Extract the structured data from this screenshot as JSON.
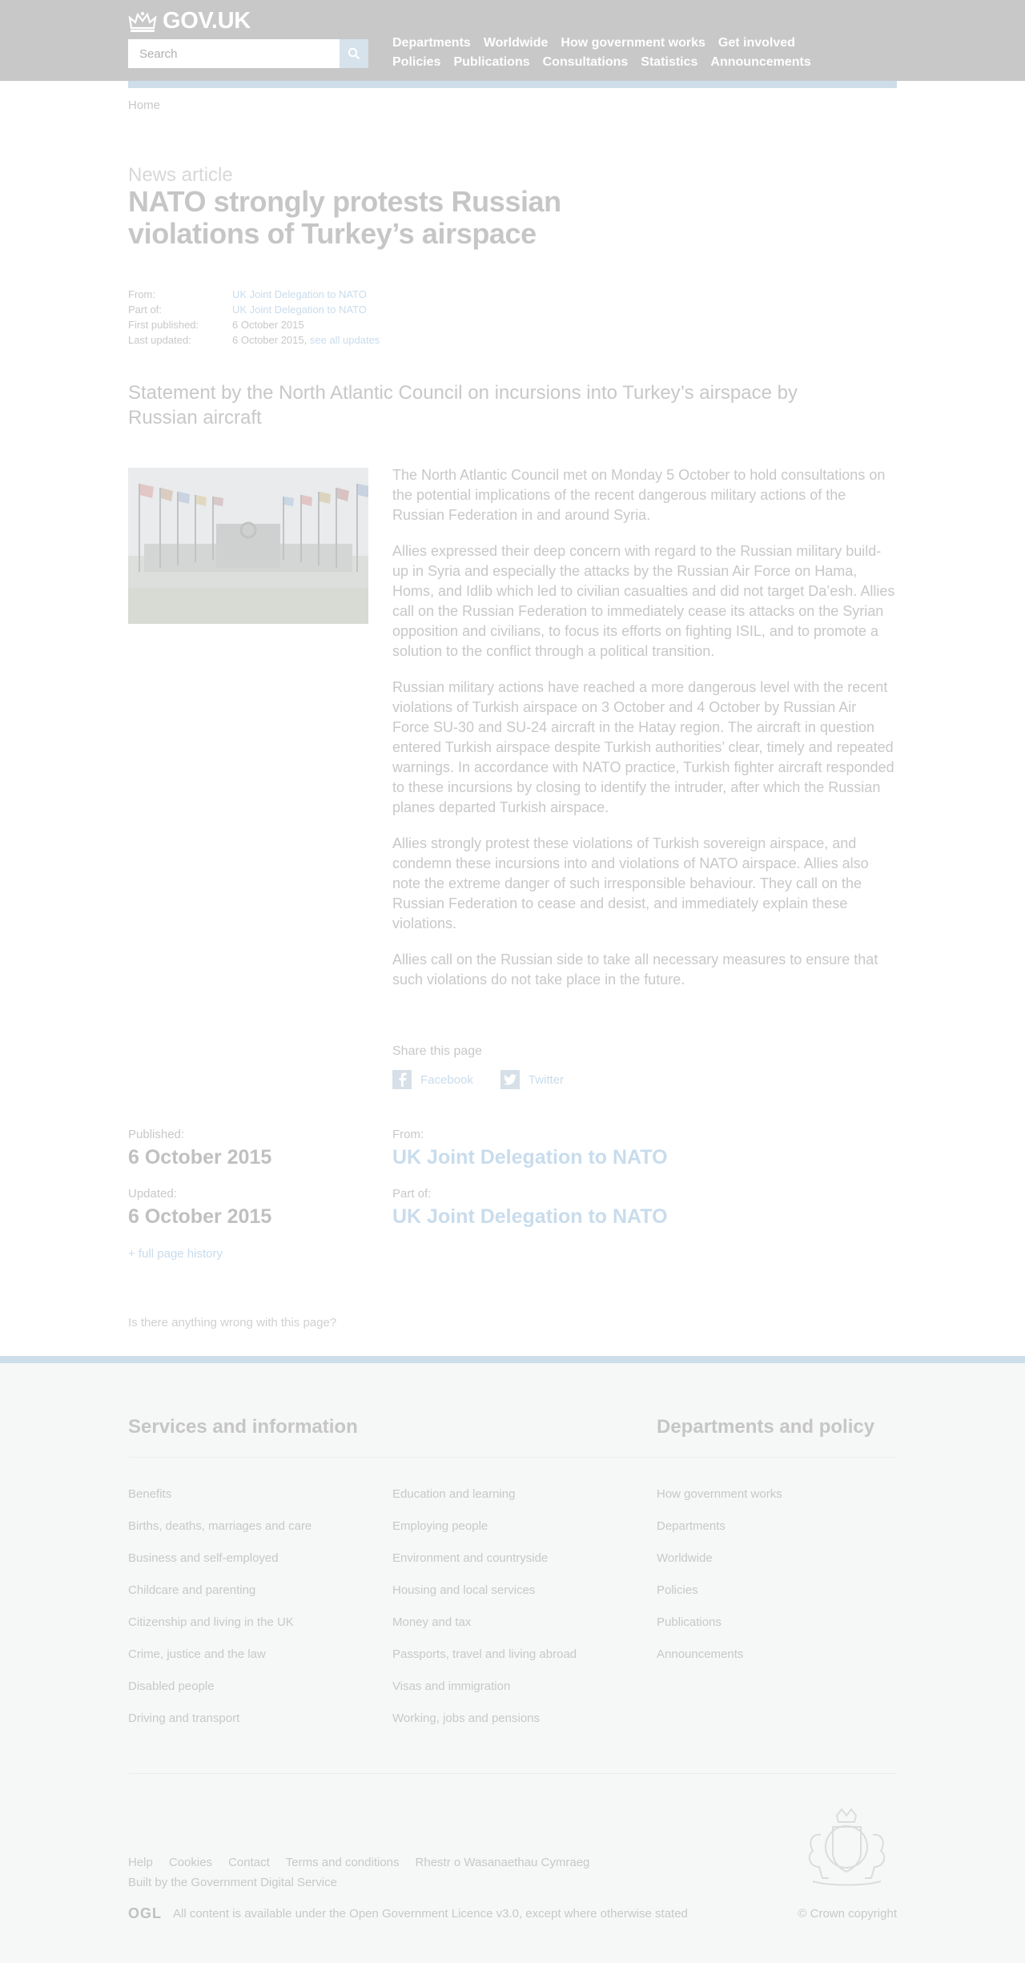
{
  "header": {
    "logo_text": "GOV.UK",
    "search_placeholder": "Search",
    "nav_row1": [
      "Departments",
      "Worldwide",
      "How government works",
      "Get involved"
    ],
    "nav_row2": [
      "Policies",
      "Publications",
      "Consultations",
      "Statistics",
      "Announcements"
    ]
  },
  "breadcrumb": {
    "home": "Home"
  },
  "article": {
    "kicker": "News article",
    "title": "NATO strongly protests Russian violations of Turkey’s airspace",
    "meta": {
      "from_label": "From:",
      "from_value": "UK Joint Delegation to NATO",
      "partof_label": "Part of:",
      "partof_value": "UK Joint Delegation to NATO",
      "first_published_label": "First published:",
      "first_published_value": "6 October 2015",
      "last_updated_label": "Last updated:",
      "last_updated_value": "6 October 2015,",
      "see_all_updates": "see all updates"
    },
    "summary": "Statement by the North Atlantic Council on incursions into Turkey’s airspace by Russian aircraft",
    "paragraphs": [
      "The North Atlantic Council met on Monday 5 October to hold consultations on the potential implications of the recent dangerous military actions of the Russian Federation in and around Syria.",
      "Allies expressed their deep concern with regard to the Russian military build-up in Syria and especially the attacks by the Russian Air Force on Hama, Homs, and Idlib which led to civilian casualties and did not target Da’esh. Allies call on the Russian Federation to immediately cease its attacks on the Syrian opposition and civilians, to focus its efforts on fighting ISIL, and to promote a solution to the conflict through a political transition.",
      "Russian military actions have reached a more dangerous level with the recent violations of Turkish airspace on 3 October and 4 October by Russian Air Force SU-30 and SU-24 aircraft in the Hatay region. The aircraft in question entered Turkish airspace despite Turkish authorities’ clear, timely and repeated warnings. In accordance with NATO practice, Turkish fighter aircraft responded to these incursions by closing to identify the intruder, after which the Russian planes departed Turkish airspace.",
      "Allies strongly protest these violations of Turkish sovereign airspace, and condemn these incursions into and violations of NATO airspace. Allies also note the extreme danger of such irresponsible behaviour. They call on the Russian Federation to cease and desist, and immediately explain these violations.",
      "Allies call on the Russian side to take all necessary measures to ensure that such violations do not take place in the future."
    ]
  },
  "share": {
    "label": "Share this page",
    "facebook": "Facebook",
    "twitter": "Twitter"
  },
  "details": {
    "published_label": "Published:",
    "published_value": "6 October 2015",
    "updated_label": "Updated:",
    "updated_value": "6 October 2015",
    "from_label": "From:",
    "from_value": "UK Joint Delegation to NATO",
    "partof_label": "Part of:",
    "partof_value": "UK Joint Delegation to NATO",
    "history_link": "+ full page history",
    "report_link": "Is there anything wrong with this page?"
  },
  "footer": {
    "services_heading": "Services and information",
    "departments_heading": "Departments and policy",
    "col1": [
      "Benefits",
      "Births, deaths, marriages and care",
      "Business and self-employed",
      "Childcare and parenting",
      "Citizenship and living in the UK",
      "Crime, justice and the law",
      "Disabled people",
      "Driving and transport"
    ],
    "col2": [
      "Education and learning",
      "Employing people",
      "Environment and countryside",
      "Housing and local services",
      "Money and tax",
      "Passports, travel and living abroad",
      "Visas and immigration",
      "Working, jobs and pensions"
    ],
    "col3": [
      "How government works",
      "Departments",
      "Worldwide",
      "Policies",
      "Publications",
      "Announcements"
    ],
    "bottom_links": [
      "Help",
      "Cookies",
      "Contact",
      "Terms and conditions",
      "Rhestr o Wasanaethau Cymraeg"
    ],
    "built_by_prefix": "Built by the",
    "built_by_link": "Government Digital Service",
    "ogl": "OGL",
    "licence_prefix": "All content is available under the",
    "licence_link": "Open Government Licence v3.0",
    "licence_suffix": ", except where otherwise stated",
    "copyright": "© Crown copyright"
  }
}
